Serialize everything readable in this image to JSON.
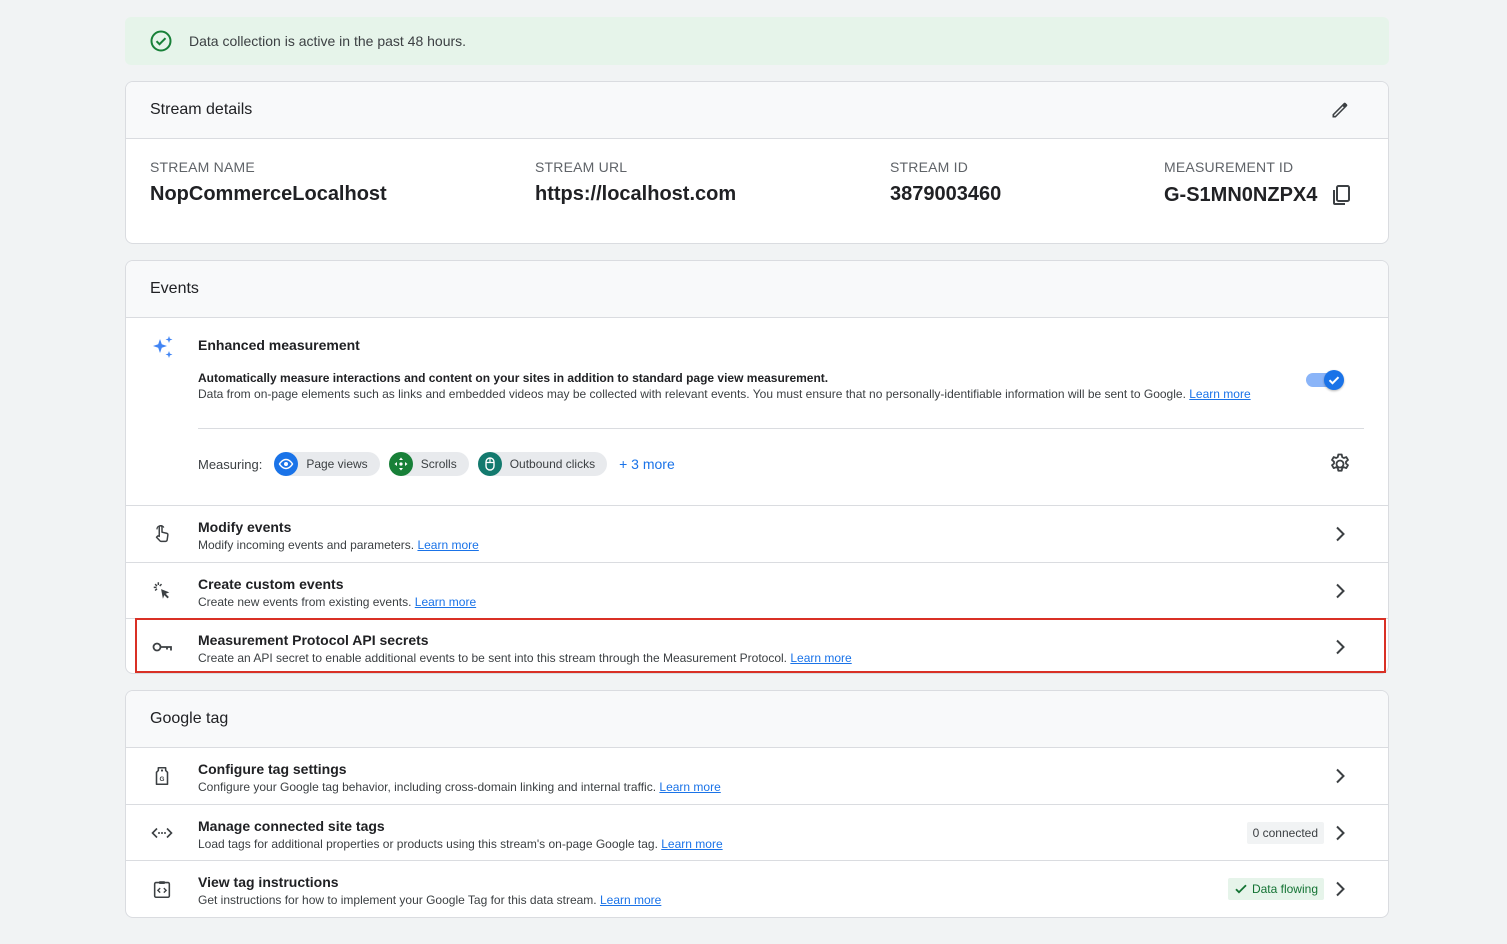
{
  "banner": {
    "text": "Data collection is active in the past 48 hours."
  },
  "stream": {
    "header": "Stream details",
    "name_label": "STREAM NAME",
    "name": "NopCommerceLocalhost",
    "url_label": "STREAM URL",
    "url": "https://localhost.com",
    "id_label": "STREAM ID",
    "id": "3879003460",
    "mid_label": "MEASUREMENT ID",
    "mid": "G-S1MN0NZPX4"
  },
  "events": {
    "header": "Events",
    "enhanced": {
      "title": "Enhanced measurement",
      "desc_bold": "Automatically measure interactions and content on your sites in addition to standard page view measurement.",
      "desc": "Data from on-page elements such as links and embedded videos may be collected with relevant events. You must ensure that no personally-identifiable information will be sent to Google.",
      "learn_more": "Learn more",
      "measuring_label": "Measuring:",
      "chips": [
        "Page views",
        "Scrolls",
        "Outbound clicks"
      ],
      "more": "+ 3 more",
      "enabled": true
    },
    "rows": [
      {
        "title": "Modify events",
        "desc": "Modify incoming events and parameters.",
        "link": "Learn more"
      },
      {
        "title": "Create custom events",
        "desc": "Create new events from existing events.",
        "link": "Learn more"
      },
      {
        "title": "Measurement Protocol API secrets",
        "desc": "Create an API secret to enable additional events to be sent into this stream through the Measurement Protocol.",
        "link": "Learn more"
      }
    ]
  },
  "tag": {
    "header": "Google tag",
    "rows": [
      {
        "title": "Configure tag settings",
        "desc": "Configure your Google tag behavior, including cross-domain linking and internal traffic.",
        "link": "Learn more"
      },
      {
        "title": "Manage connected site tags",
        "desc": "Load tags for additional properties or products using this stream's on-page Google tag.",
        "link": "Learn more",
        "badge": "0 connected"
      },
      {
        "title": "View tag instructions",
        "desc": "Get instructions for how to implement your Google Tag for this data stream.",
        "link": "Learn more",
        "badge": "Data flowing"
      }
    ]
  },
  "colors": {
    "accent": "#1a73e8",
    "success": "#188038",
    "highlight": "#d93025"
  }
}
